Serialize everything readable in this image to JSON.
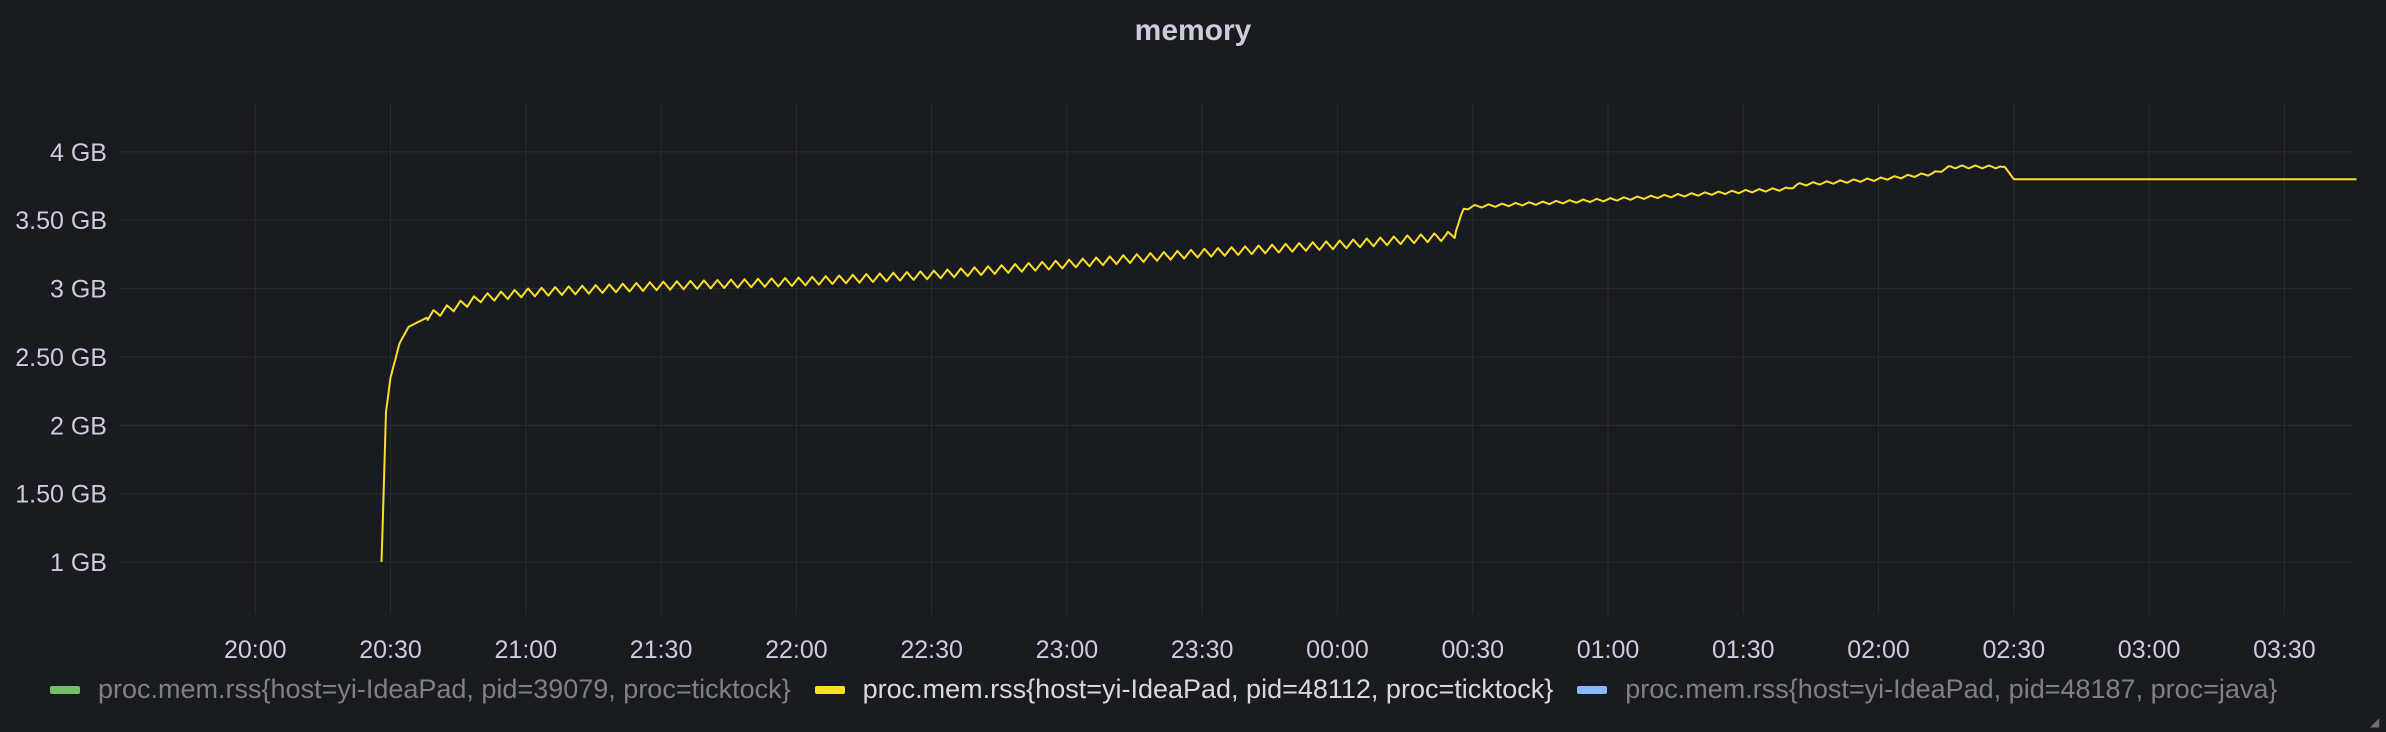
{
  "panel": {
    "title": "memory"
  },
  "chart_data": {
    "type": "line",
    "title": "memory",
    "xlabel": "",
    "ylabel": "",
    "grid": true,
    "legend_position": "bottom",
    "x_range_hours": [
      19.5,
      27.75
    ],
    "ylim": [
      0.62,
      4.35
    ],
    "x_ticks": [
      "20:00",
      "20:30",
      "21:00",
      "21:30",
      "22:00",
      "22:30",
      "23:00",
      "23:30",
      "00:00",
      "00:30",
      "01:00",
      "01:30",
      "02:00",
      "02:30",
      "03:00",
      "03:30"
    ],
    "y_ticks": [
      {
        "value": 1.0,
        "label": "1 GB"
      },
      {
        "value": 1.5,
        "label": "1.50 GB"
      },
      {
        "value": 2.0,
        "label": "2 GB"
      },
      {
        "value": 2.5,
        "label": "2.50 GB"
      },
      {
        "value": 3.0,
        "label": "3 GB"
      },
      {
        "value": 3.5,
        "label": "3.50 GB"
      },
      {
        "value": 4.0,
        "label": "4 GB"
      }
    ],
    "y_unit": "GB",
    "series": [
      {
        "name": "proc.mem.rss{host=yi-IdeaPad, pid=39079, proc=ticktock}",
        "color": "#73bf69",
        "visible": false,
        "points": []
      },
      {
        "name": "proc.mem.rss{host=yi-IdeaPad, pid=48112, proc=ticktock}",
        "color": "#fade2a",
        "visible": true,
        "sawtooth_amplitude_gb": 0.06,
        "sawtooth_period_hours": 0.05,
        "points": [
          {
            "x": "20:28",
            "y": 1.0
          },
          {
            "x": "20:29",
            "y": 2.1
          },
          {
            "x": "20:30",
            "y": 2.35
          },
          {
            "x": "20:32",
            "y": 2.6
          },
          {
            "x": "20:34",
            "y": 2.72
          },
          {
            "x": "20:40",
            "y": 2.82
          },
          {
            "x": "20:50",
            "y": 2.93
          },
          {
            "x": "21:00",
            "y": 2.97
          },
          {
            "x": "21:30",
            "y": 3.02
          },
          {
            "x": "22:00",
            "y": 3.05
          },
          {
            "x": "22:30",
            "y": 3.1
          },
          {
            "x": "23:00",
            "y": 3.18
          },
          {
            "x": "23:30",
            "y": 3.26
          },
          {
            "x": "00:00",
            "y": 3.32
          },
          {
            "x": "00:24",
            "y": 3.38
          },
          {
            "x": "00:26",
            "y": 3.4
          },
          {
            "x": "00:28",
            "y": 3.58
          },
          {
            "x": "00:30",
            "y": 3.6
          },
          {
            "x": "01:00",
            "y": 3.65
          },
          {
            "x": "01:30",
            "y": 3.71
          },
          {
            "x": "01:40",
            "y": 3.73
          },
          {
            "x": "01:42",
            "y": 3.76
          },
          {
            "x": "02:00",
            "y": 3.8
          },
          {
            "x": "02:12",
            "y": 3.84
          },
          {
            "x": "02:16",
            "y": 3.89
          },
          {
            "x": "02:28",
            "y": 3.89
          },
          {
            "x": "02:30",
            "y": 3.8
          },
          {
            "x": "03:46",
            "y": 3.8
          }
        ]
      },
      {
        "name": "proc.mem.rss{host=yi-IdeaPad, pid=48187, proc=java}",
        "color": "#8ab8ff",
        "visible": false,
        "points": []
      }
    ]
  }
}
